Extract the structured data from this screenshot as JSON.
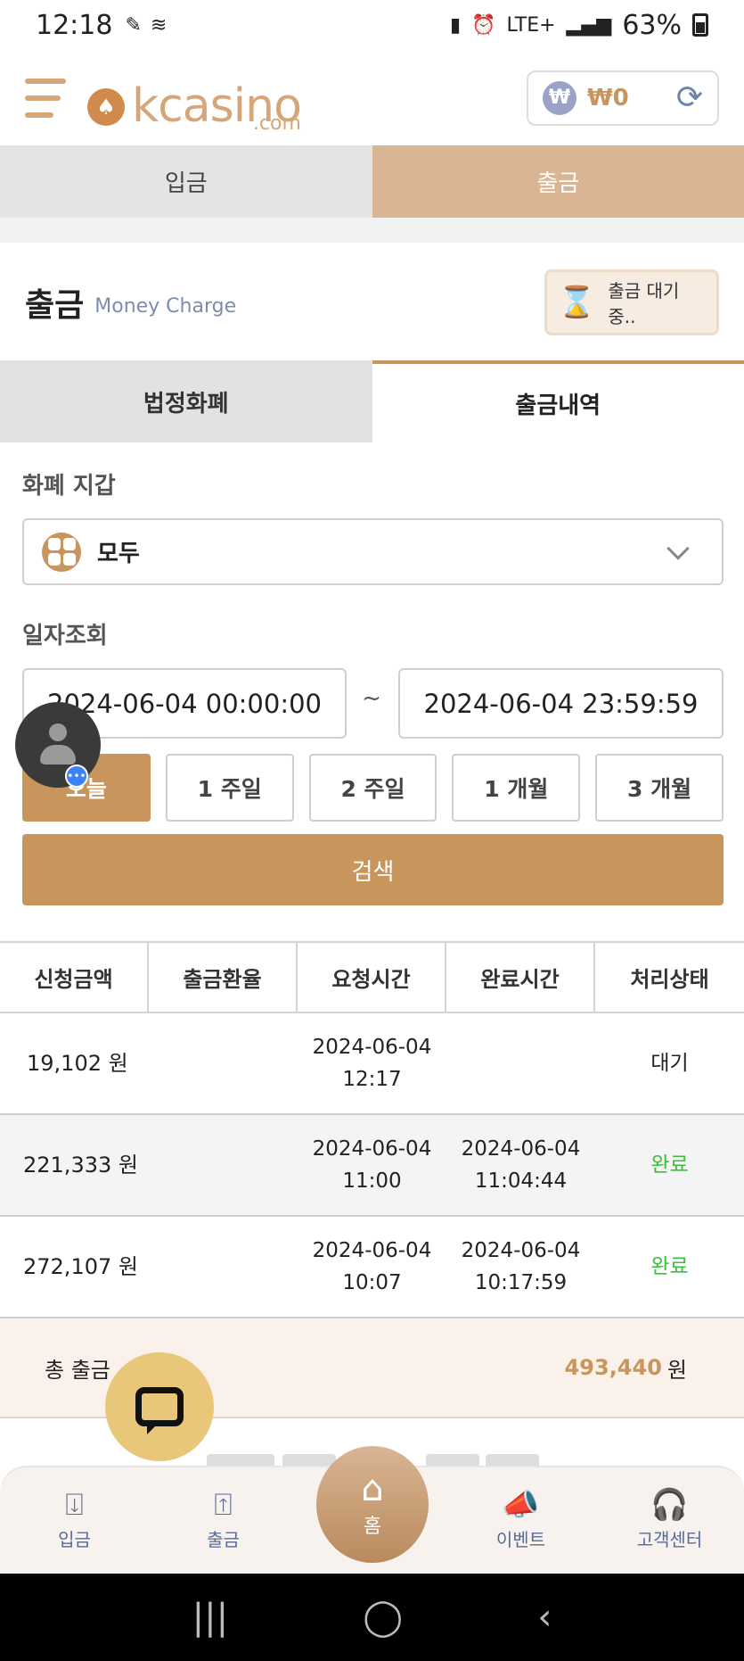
{
  "status_bar": {
    "time": "12:18",
    "network": "LTE+",
    "battery": "63%"
  },
  "header": {
    "logo_text": "kcasino",
    "logo_sub": ".com",
    "wallet_currency": "₩",
    "wallet_balance": "₩0"
  },
  "top_tabs": {
    "deposit": "입금",
    "withdraw": "출금"
  },
  "section": {
    "title": "출금",
    "subtitle": "Money Charge",
    "pending_label": "출금 대기 중.."
  },
  "sub_tabs": {
    "fiat": "법정화폐",
    "history": "출금내역"
  },
  "form": {
    "wallet_label": "화폐 지갑",
    "wallet_value": "모두",
    "date_label": "일자조회",
    "date_from": "2024-06-04 00:00:00",
    "date_to": "2024-06-04 23:59:59",
    "tilde": "~",
    "periods": [
      "오늘",
      "1 주일",
      "2 주일",
      "1 개월",
      "3 개월"
    ],
    "search_label": "검색"
  },
  "table": {
    "headers": [
      "신청금액",
      "출금환율",
      "요청시간",
      "완료시간",
      "처리상태"
    ],
    "rows": [
      {
        "amount": "19,102 원",
        "rate": "",
        "req_date": "2024-06-04",
        "req_time": "12:17",
        "done_date": "",
        "done_time": "",
        "status": "대기"
      },
      {
        "amount": "221,333 원",
        "rate": "",
        "req_date": "2024-06-04",
        "req_time": "11:00",
        "done_date": "2024-06-04",
        "done_time": "11:04:44",
        "status": "완료"
      },
      {
        "amount": "272,107 원",
        "rate": "",
        "req_date": "2024-06-04",
        "req_time": "10:07",
        "done_date": "2024-06-04",
        "done_time": "10:17:59",
        "status": "완료"
      }
    ],
    "total_label": "총 출금",
    "total_value": "493,440",
    "total_unit": "원"
  },
  "bottom_nav": {
    "deposit": "입금",
    "withdraw": "출금",
    "home": "홈",
    "event": "이벤트",
    "support": "고객센터"
  },
  "colors": {
    "accent": "#c8955c",
    "tab_active": "#d9b593",
    "status_done": "#3cbf3c",
    "nav_text": "#5a6b96"
  }
}
